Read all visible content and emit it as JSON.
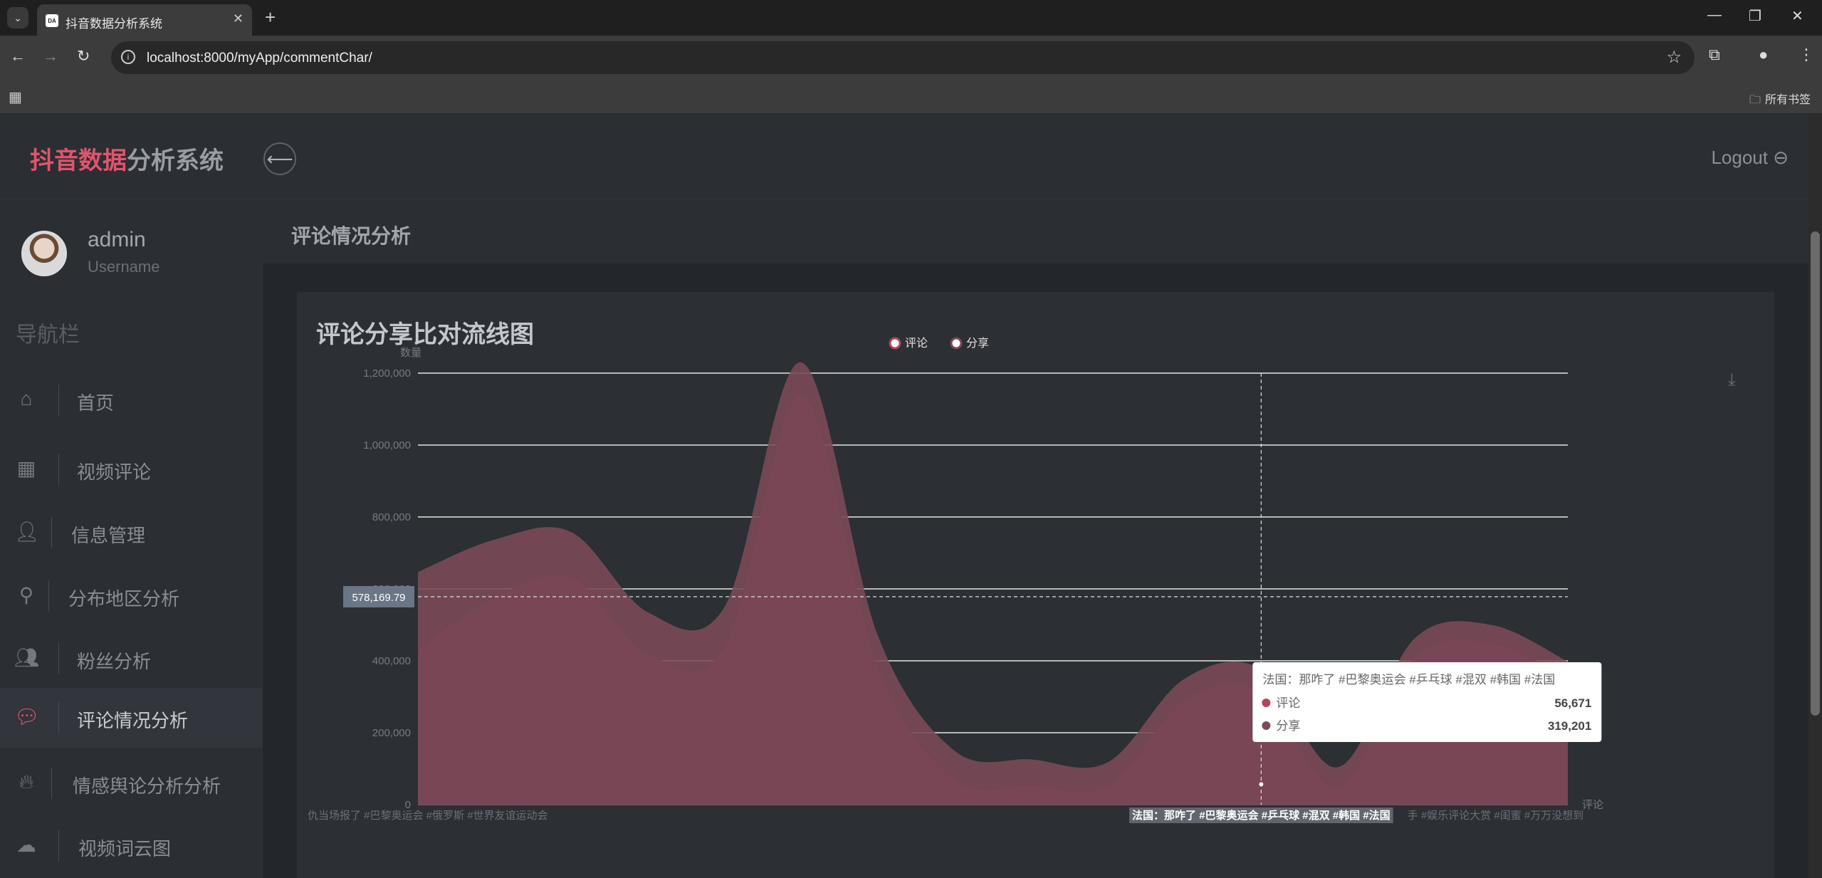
{
  "browser": {
    "tab_favicon": "DA",
    "tab_title": "抖音数据分析系统",
    "url": "localhost:8000/myApp/commentChar/",
    "bookmarks_label": "所有书签"
  },
  "header": {
    "brand_highlight": "抖音数据",
    "brand_rest": "分析系统",
    "logout_label": "Logout"
  },
  "user": {
    "name": "admin",
    "role": "Username"
  },
  "sidebar": {
    "title": "导航栏",
    "items": [
      {
        "label": "首页",
        "icon": "home-icon"
      },
      {
        "label": "视频评论",
        "icon": "grid-icon"
      },
      {
        "label": "信息管理",
        "icon": "user-icon"
      },
      {
        "label": "分布地区分析",
        "icon": "map-pin-icon"
      },
      {
        "label": "粉丝分析",
        "icon": "users-icon"
      },
      {
        "label": "评论情况分析",
        "icon": "comment-icon",
        "active": true
      },
      {
        "label": "情感舆论分析分析",
        "icon": "fire-icon"
      },
      {
        "label": "视频词云图",
        "icon": "cloud-upload-icon"
      }
    ]
  },
  "page": {
    "title": "评论情况分析",
    "card_title": "评论分享比对流线图"
  },
  "colors": {
    "accent": "#e0546d",
    "series_comment": "#b3455f",
    "series_share": "#7a4a57"
  },
  "chart_data": {
    "type": "area",
    "title": "",
    "ylabel": "数量",
    "xlabel": "评论",
    "ylim": [
      0,
      1200000
    ],
    "yticks": [
      0,
      200000,
      400000,
      600000,
      800000,
      1000000,
      1200000
    ],
    "stacked": true,
    "smooth": true,
    "grid": true,
    "legend_position": "top-center",
    "categories": [
      "仇当场报了 #巴黎奥运会 #俄罗斯 #世界友谊运动会",
      "",
      "",
      "",
      "",
      "",
      "",
      "",
      "",
      "",
      "",
      "法国：那咋了 #巴黎奥运会 #乒乓球 #混双 #韩国 #法国",
      "",
      "手 #娱乐评论大赏 #闺蜜 #万万没想到",
      "",
      ""
    ],
    "series": [
      {
        "name": "评论",
        "values": [
          432000,
          577000,
          633000,
          420000,
          440000,
          1140000,
          385000,
          70000,
          54000,
          53000,
          290000,
          320000,
          50000,
          410000,
          450000,
          350000
        ]
      },
      {
        "name": "分享",
        "values": [
          215000,
          160000,
          125000,
          115000,
          110000,
          90000,
          85000,
          80000,
          72000,
          65000,
          60000,
          56671,
          54000,
          52000,
          50000,
          48000
        ]
      }
    ],
    "crosshair": {
      "category_index": 11,
      "y_value_label": "578,169.79"
    },
    "tooltip": {
      "title": "法国：那咋了 #巴黎奥运会 #乒乓球 #混双 #韩国 #法国",
      "rows": [
        {
          "name": "评论",
          "value": "56,671"
        },
        {
          "name": "分享",
          "value": "319,201"
        }
      ]
    }
  }
}
